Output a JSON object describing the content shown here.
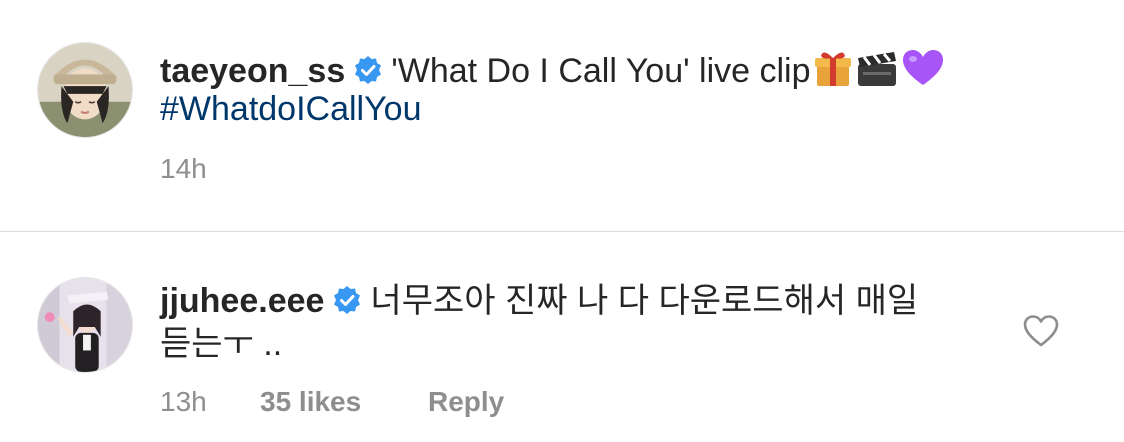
{
  "post": {
    "username": "taeyeon_ss",
    "caption": "'What Do I Call You'  live clip",
    "emojis": [
      "gift-icon",
      "clapperboard-icon",
      "purple-heart-icon"
    ],
    "hashtag": "#WhatdoICallYou",
    "timestamp": "14h"
  },
  "comment": {
    "username": "jjuhee.eee",
    "text_line1": "너무조아 진짜 나 다 다운로드해서 매일",
    "text_line2": "듣는ㅜ ..",
    "timestamp": "13h",
    "likes": "35 likes",
    "reply_label": "Reply"
  },
  "colors": {
    "primary_text": "#262626",
    "secondary_text": "#8e8e8e",
    "hashtag": "#00376b",
    "verified_badge": "#3897f0",
    "divider": "#dbdbdb"
  }
}
